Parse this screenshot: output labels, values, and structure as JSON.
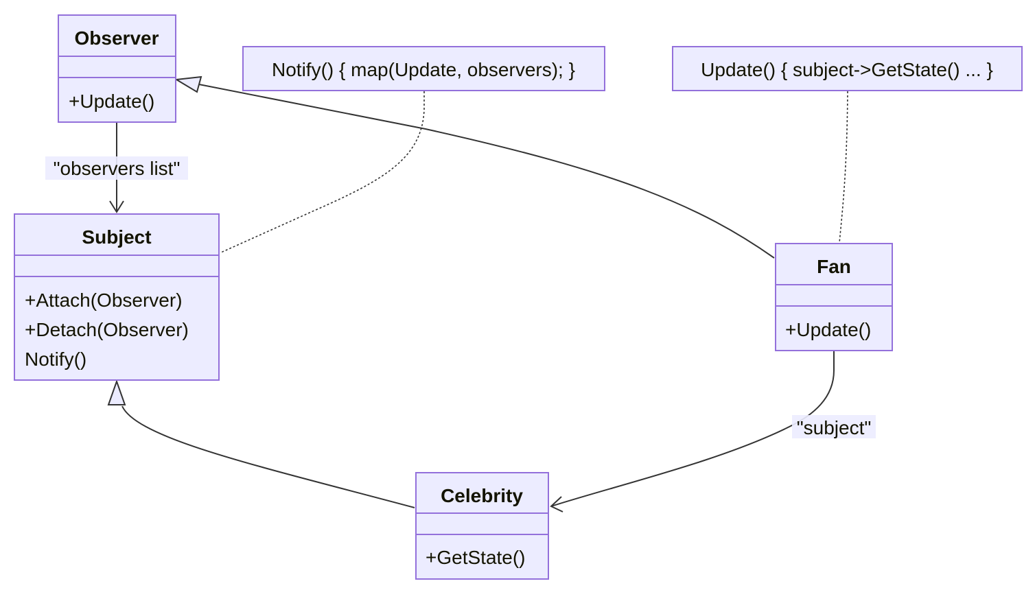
{
  "colors": {
    "node_fill": "#ECECFF",
    "node_stroke": "#9370DB",
    "edge": "#333333",
    "text": "#131300"
  },
  "classes": {
    "observer": {
      "name": "Observer",
      "methods": [
        "+Update()"
      ]
    },
    "subject": {
      "name": "Subject",
      "methods": [
        "+Attach(Observer)",
        "+Detach(Observer)",
        "Notify()"
      ]
    },
    "fan": {
      "name": "Fan",
      "methods": [
        "+Update()"
      ]
    },
    "celebrity": {
      "name": "Celebrity",
      "methods": [
        "+GetState()"
      ]
    }
  },
  "notes": [
    {
      "text": "Notify() { map(Update, observers); }",
      "attached_to": "Subject"
    },
    {
      "text": "Update() { subject->GetState() ... }",
      "attached_to": "Fan"
    }
  ],
  "relations": [
    {
      "from": "Observer",
      "to": "Subject",
      "type": "association",
      "label": "\"observers list\""
    },
    {
      "from": "Fan",
      "to": "Observer",
      "type": "inheritance",
      "label": ""
    },
    {
      "from": "Celebrity",
      "to": "Subject",
      "type": "inheritance",
      "label": ""
    },
    {
      "from": "Fan",
      "to": "Celebrity",
      "type": "association",
      "label": "\"subject\""
    }
  ]
}
